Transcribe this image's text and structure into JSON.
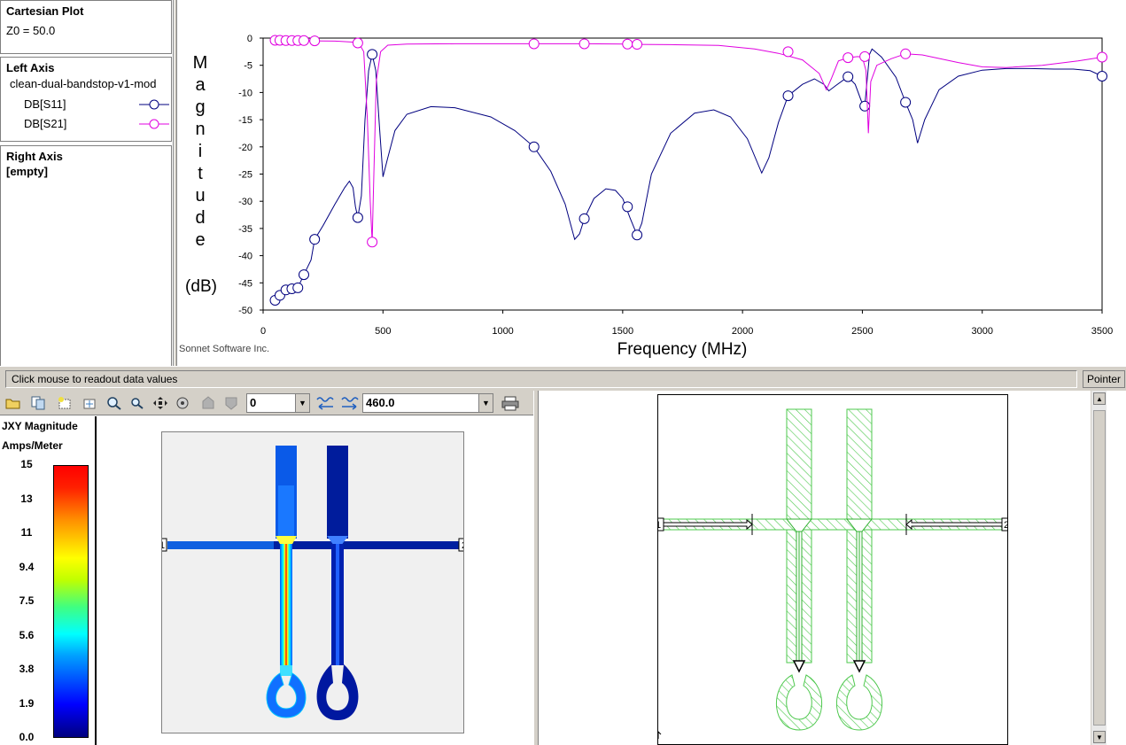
{
  "legend": {
    "title": "Cartesian Plot",
    "z0": "Z0 = 50.0",
    "left_axis_title": "Left Axis",
    "project": "clean-dual-bandstop-v1-mod",
    "traces": [
      {
        "label": "DB[S11]",
        "color": "#00007f"
      },
      {
        "label": "DB[S21]",
        "color": "#e000e0"
      }
    ],
    "right_axis_title": "Right Axis",
    "right_axis_value": "[empty]"
  },
  "chart": {
    "ylabel_letters": [
      "M",
      "a",
      "g",
      "n",
      "i",
      "t",
      "u",
      "d",
      "e"
    ],
    "ylabel_unit": "(dB)",
    "xlabel": "Frequency (MHz)",
    "credit": "Sonnet Software Inc."
  },
  "chart_data": {
    "type": "line",
    "xlabel": "Frequency (MHz)",
    "ylabel": "Magnitude (dB)",
    "xlim": [
      0,
      3500
    ],
    "ylim": [
      -50,
      0
    ],
    "x_ticks": [
      0,
      500,
      1000,
      1500,
      2000,
      2500,
      3000,
      3500
    ],
    "y_ticks": [
      0,
      -5,
      -10,
      -15,
      -20,
      -25,
      -30,
      -35,
      -40,
      -45,
      -50
    ],
    "grid": false,
    "series": [
      {
        "name": "DB[S11]",
        "color": "#00007f",
        "curve": [
          [
            50,
            -48.2
          ],
          [
            70,
            -47.3
          ],
          [
            95,
            -46.3
          ],
          [
            120,
            -46.1
          ],
          [
            145,
            -45.9
          ],
          [
            170,
            -43.5
          ],
          [
            200,
            -40.8
          ],
          [
            215,
            -37.0
          ],
          [
            250,
            -34.5
          ],
          [
            300,
            -30.5
          ],
          [
            340,
            -27.5
          ],
          [
            360,
            -26.3
          ],
          [
            375,
            -27.5
          ],
          [
            385,
            -31.0
          ],
          [
            395,
            -33.0
          ],
          [
            410,
            -29.0
          ],
          [
            425,
            -15.0
          ],
          [
            440,
            -6.0
          ],
          [
            455,
            -3.0
          ],
          [
            470,
            -6.0
          ],
          [
            485,
            -16.0
          ],
          [
            500,
            -25.5
          ],
          [
            520,
            -22.0
          ],
          [
            550,
            -17.0
          ],
          [
            600,
            -14.0
          ],
          [
            700,
            -12.6
          ],
          [
            800,
            -12.8
          ],
          [
            950,
            -14.5
          ],
          [
            1050,
            -17.0
          ],
          [
            1130,
            -20.0
          ],
          [
            1200,
            -24.5
          ],
          [
            1260,
            -30.5
          ],
          [
            1300,
            -37.0
          ],
          [
            1320,
            -36.0
          ],
          [
            1340,
            -33.2
          ],
          [
            1380,
            -29.5
          ],
          [
            1430,
            -27.7
          ],
          [
            1470,
            -28.0
          ],
          [
            1500,
            -29.5
          ],
          [
            1530,
            -33.0
          ],
          [
            1560,
            -36.2
          ],
          [
            1580,
            -34.0
          ],
          [
            1620,
            -25.0
          ],
          [
            1700,
            -17.5
          ],
          [
            1800,
            -13.8
          ],
          [
            1880,
            -13.2
          ],
          [
            1950,
            -14.5
          ],
          [
            2020,
            -18.5
          ],
          [
            2080,
            -24.8
          ],
          [
            2110,
            -22.0
          ],
          [
            2150,
            -15.5
          ],
          [
            2190,
            -10.6
          ],
          [
            2250,
            -8.5
          ],
          [
            2300,
            -7.5
          ],
          [
            2340,
            -8.5
          ],
          [
            2360,
            -9.7
          ],
          [
            2390,
            -8.7
          ],
          [
            2440,
            -7.1
          ],
          [
            2470,
            -8.5
          ],
          [
            2495,
            -11.5
          ],
          [
            2510,
            -12.5
          ],
          [
            2530,
            -3.0
          ],
          [
            2540,
            -2.0
          ],
          [
            2580,
            -3.5
          ],
          [
            2640,
            -7.2
          ],
          [
            2680,
            -11.8
          ],
          [
            2710,
            -15.0
          ],
          [
            2730,
            -19.3
          ],
          [
            2760,
            -15.0
          ],
          [
            2820,
            -9.5
          ],
          [
            2900,
            -7.0
          ],
          [
            3000,
            -5.9
          ],
          [
            3100,
            -5.6
          ],
          [
            3200,
            -5.6
          ],
          [
            3300,
            -5.7
          ],
          [
            3380,
            -5.7
          ],
          [
            3450,
            -6.0
          ],
          [
            3500,
            -7.0
          ]
        ],
        "markers": [
          [
            50,
            -48.2
          ],
          [
            70,
            -47.3
          ],
          [
            95,
            -46.3
          ],
          [
            120,
            -46.1
          ],
          [
            145,
            -45.9
          ],
          [
            170,
            -43.5
          ],
          [
            215,
            -37.0
          ],
          [
            395,
            -33.0
          ],
          [
            455,
            -3.0
          ],
          [
            1130,
            -20.0
          ],
          [
            1340,
            -33.2
          ],
          [
            1520,
            -31.0
          ],
          [
            1560,
            -36.2
          ],
          [
            2190,
            -10.6
          ],
          [
            2440,
            -7.1
          ],
          [
            2510,
            -12.5
          ],
          [
            2680,
            -11.8
          ],
          [
            3500,
            -7.0
          ]
        ]
      },
      {
        "name": "DB[S21]",
        "color": "#e000e0",
        "curve": [
          [
            50,
            -0.4
          ],
          [
            100,
            -0.45
          ],
          [
            200,
            -0.5
          ],
          [
            300,
            -0.55
          ],
          [
            380,
            -0.75
          ],
          [
            400,
            -0.95
          ],
          [
            420,
            -2.5
          ],
          [
            435,
            -15.0
          ],
          [
            447,
            -30.0
          ],
          [
            455,
            -37.5
          ],
          [
            462,
            -25.0
          ],
          [
            472,
            -8.0
          ],
          [
            490,
            -2.5
          ],
          [
            520,
            -1.3
          ],
          [
            600,
            -1.1
          ],
          [
            800,
            -1.05
          ],
          [
            1000,
            -1.05
          ],
          [
            1130,
            -1.05
          ],
          [
            1340,
            -1.05
          ],
          [
            1520,
            -1.1
          ],
          [
            1560,
            -1.15
          ],
          [
            1700,
            -1.2
          ],
          [
            1900,
            -1.35
          ],
          [
            2050,
            -2.0
          ],
          [
            2150,
            -2.8
          ],
          [
            2250,
            -4.0
          ],
          [
            2320,
            -6.5
          ],
          [
            2350,
            -9.5
          ],
          [
            2370,
            -7.5
          ],
          [
            2400,
            -4.2
          ],
          [
            2440,
            -3.6
          ],
          [
            2480,
            -3.4
          ],
          [
            2500,
            -3.5
          ],
          [
            2515,
            -6.0
          ],
          [
            2525,
            -17.5
          ],
          [
            2535,
            -8.0
          ],
          [
            2560,
            -5.0
          ],
          [
            2620,
            -3.8
          ],
          [
            2680,
            -2.9
          ],
          [
            2750,
            -3.1
          ],
          [
            2900,
            -4.5
          ],
          [
            3000,
            -5.3
          ],
          [
            3100,
            -5.4
          ],
          [
            3250,
            -5.0
          ],
          [
            3400,
            -4.2
          ],
          [
            3500,
            -3.5
          ]
        ],
        "markers": [
          [
            50,
            -0.4
          ],
          [
            70,
            -0.4
          ],
          [
            95,
            -0.45
          ],
          [
            120,
            -0.45
          ],
          [
            145,
            -0.45
          ],
          [
            170,
            -0.45
          ],
          [
            215,
            -0.5
          ],
          [
            395,
            -0.9
          ],
          [
            455,
            -37.5
          ],
          [
            1130,
            -1.05
          ],
          [
            1340,
            -1.05
          ],
          [
            1520,
            -1.1
          ],
          [
            1560,
            -1.15
          ],
          [
            2190,
            -2.5
          ],
          [
            2440,
            -3.6
          ],
          [
            2510,
            -3.4
          ],
          [
            2680,
            -2.9
          ],
          [
            3500,
            -3.5
          ]
        ]
      }
    ]
  },
  "status": {
    "message": "Click mouse to readout data values",
    "mode": "Pointer"
  },
  "current_toolbar": {
    "level_value": "0",
    "frequency_value": "460.0"
  },
  "current_scale": {
    "title": "JXY Magnitude",
    "unit": "Amps/Meter",
    "labels": [
      "15",
      "13",
      "11",
      "9.4",
      "7.5",
      "5.6",
      "3.8",
      "1.9",
      "0.0"
    ]
  },
  "ports": {
    "port1": "1",
    "port2": "2"
  },
  "icons": {
    "open": "folder-icon",
    "copy": "copy-icon",
    "select": "select-icon",
    "zoom_in": "zoom-in-icon",
    "zoom_out": "zoom-out-icon",
    "pan": "pan-icon",
    "print": "printer-icon"
  }
}
